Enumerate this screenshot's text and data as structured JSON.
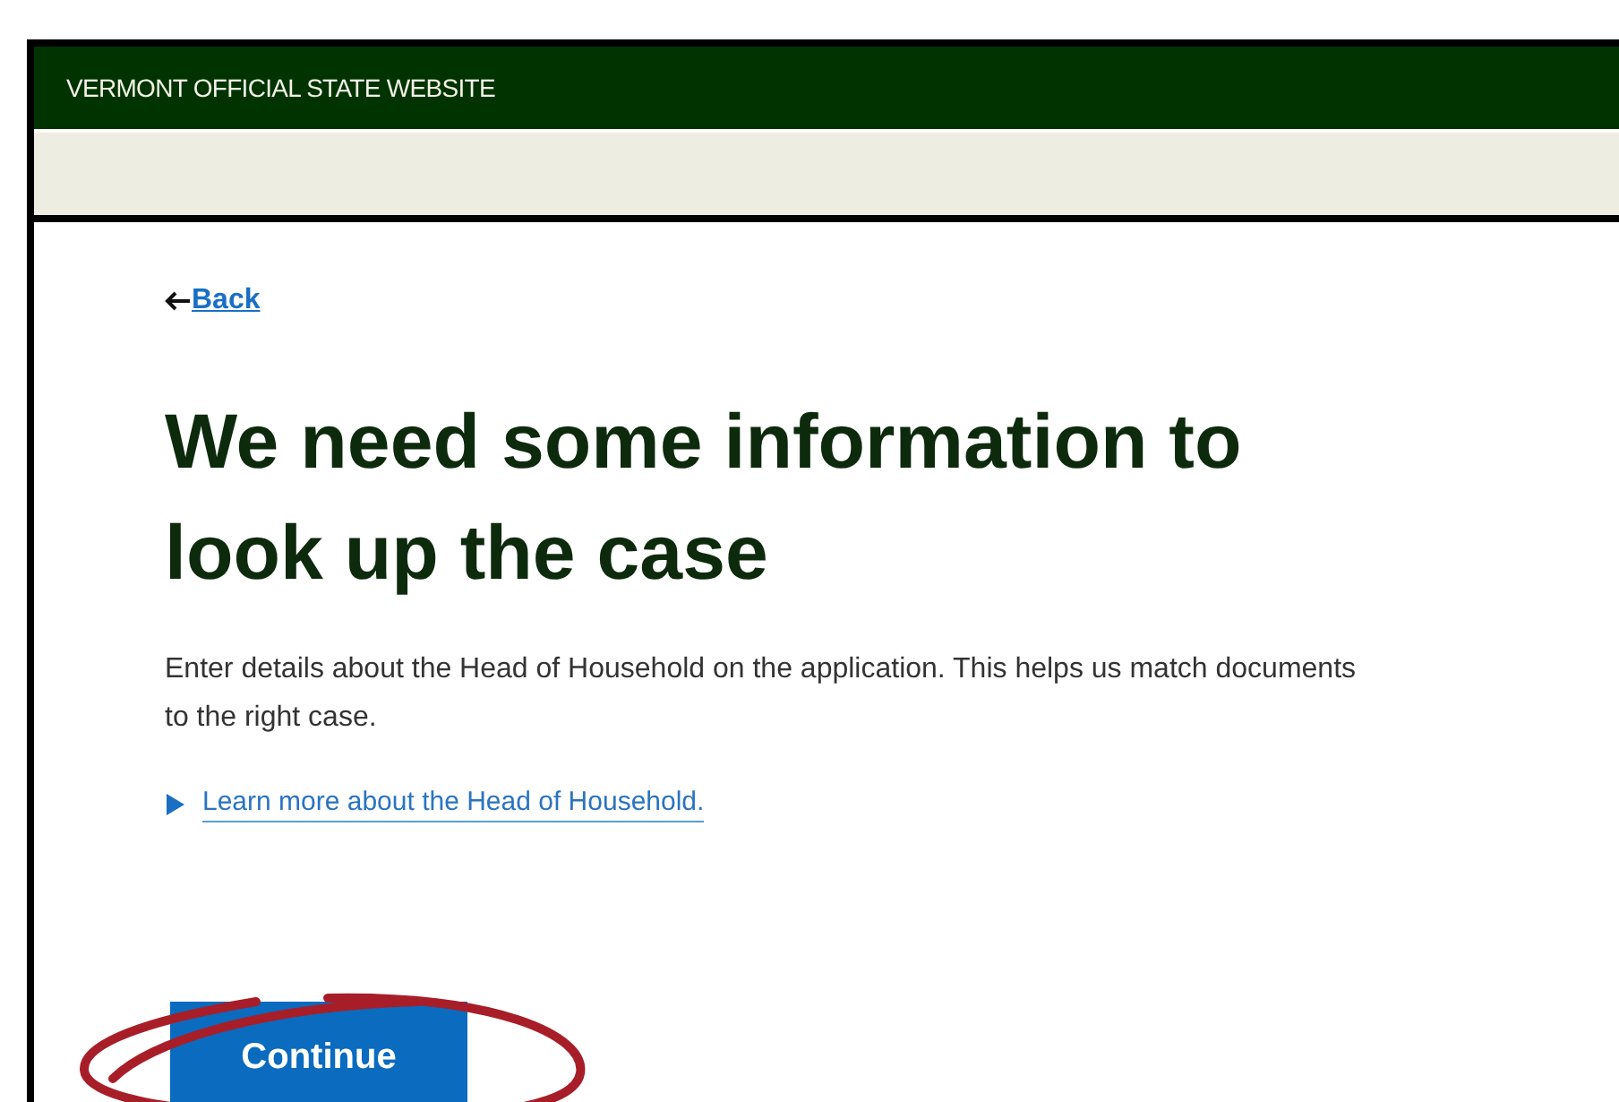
{
  "banner": {
    "title": "VERMONT OFFICIAL STATE WEBSITE"
  },
  "back_link": "Back",
  "heading": "We need some information to look up the case",
  "intro": "Enter details about the Head of Household on the application. This helps us match documents to the right case.",
  "details": {
    "summary": "Learn more about the Head of Household.",
    "expanded": false
  },
  "continue_button": "Continue"
}
